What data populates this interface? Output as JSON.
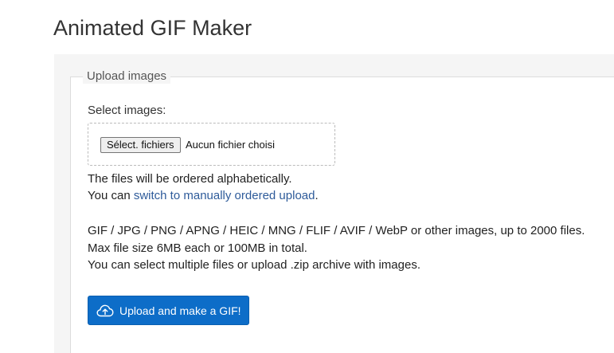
{
  "page": {
    "title": "Animated GIF Maker"
  },
  "upload_form": {
    "legend": "Upload images",
    "select_label": "Select images:",
    "file_input": {
      "button_label": "Sélect. fichiers",
      "status_text": "Aucun fichier choisi"
    },
    "order_note": "The files will be ordered alphabetically.",
    "switch_prefix": "You can ",
    "switch_link": "switch to manually ordered upload",
    "switch_suffix": ".",
    "info_lines": [
      "GIF / JPG / PNG / APNG / HEIC / MNG / FLIF / AVIF / WebP or other images, up to 2000 files.",
      "Max file size 6MB each or 100MB in total.",
      "You can select multiple files or upload .zip archive with images."
    ],
    "submit_button": {
      "label": "Upload and make a GIF!",
      "icon": "cloud-upload-icon"
    }
  },
  "colors": {
    "accent": "#0d6dc8",
    "link": "#2e5b9a",
    "panel_background": "#f5f5f5"
  }
}
